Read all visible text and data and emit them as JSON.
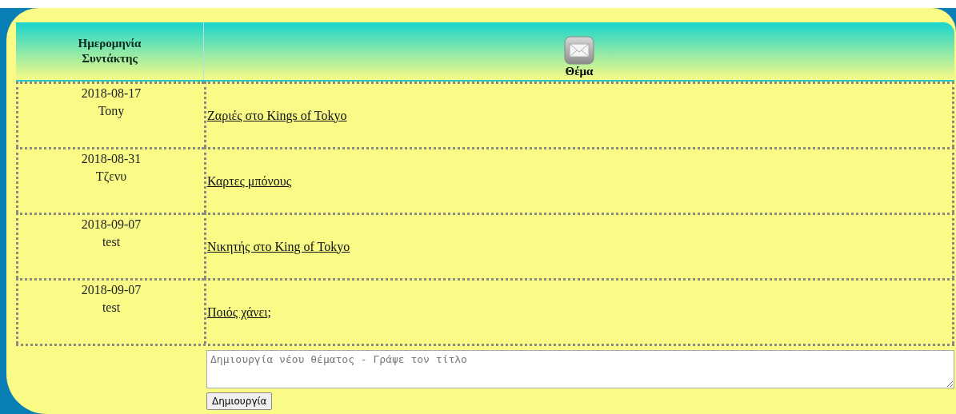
{
  "header": {
    "date_author": [
      "Ημερομηνία",
      "Συντάκτης"
    ],
    "subject": "Θέμα"
  },
  "topics": [
    {
      "date": "2018-08-17",
      "author": "Tony",
      "title": "Ζαριές στο Kings of Tokyo"
    },
    {
      "date": "2018-08-31",
      "author": "Τζενυ",
      "title": "Καρτες μπόνους"
    },
    {
      "date": "2018-09-07",
      "author": "test",
      "title": "Νικητής στο King of Tokyo"
    },
    {
      "date": "2018-09-07",
      "author": "test",
      "title": "Ποιός χάνει;"
    }
  ],
  "new_topic": {
    "placeholder": "Δημιουργία νέου θέματος - Γράψε τον τίτλο",
    "button": "Δημιουργία"
  }
}
